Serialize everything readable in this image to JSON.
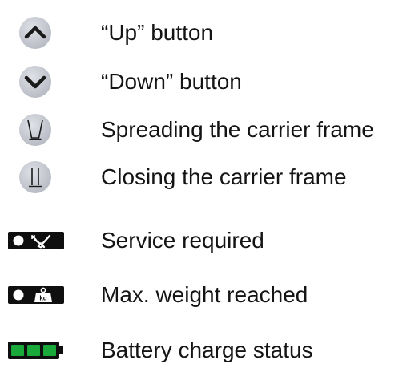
{
  "legend": [
    {
      "icon": "chevron-up-button-icon",
      "label": "“Up” button"
    },
    {
      "icon": "chevron-down-button-icon",
      "label": "“Down” button"
    },
    {
      "icon": "spread-frame-icon",
      "label": "Spreading the carrier frame"
    },
    {
      "icon": "close-frame-icon",
      "label": "Closing the carrier frame"
    },
    {
      "icon": "service-wrench-indicator-icon",
      "label": "Service required"
    },
    {
      "icon": "max-weight-kg-indicator-icon",
      "label": "Max. weight reached",
      "icon_text": "kg"
    },
    {
      "icon": "battery-charge-indicator-icon",
      "label": "Battery charge status"
    }
  ],
  "colors": {
    "button_fill": "#c4c7cf",
    "button_symbol": "#1a1a1a",
    "indicator_bg": "#0f0f0f",
    "indicator_dot": "#ffffff",
    "battery_green": "#19a83a"
  }
}
